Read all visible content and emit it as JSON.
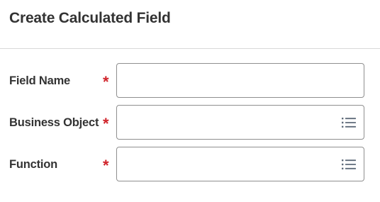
{
  "header": {
    "title": "Create Calculated Field"
  },
  "form": {
    "fields": [
      {
        "label": "Field Name",
        "required_mark": "*",
        "value": "",
        "placeholder": ""
      },
      {
        "label": "Business Object",
        "required_mark": "*",
        "value": "",
        "placeholder": "",
        "icon": "list-icon"
      },
      {
        "label": "Function",
        "required_mark": "*",
        "value": "",
        "placeholder": "",
        "icon": "list-icon"
      }
    ]
  },
  "colors": {
    "required": "#d0242b",
    "text": "#333333",
    "border": "#8f8f8f",
    "divider": "#d9d9d9",
    "icon": "#5f6b7a"
  }
}
